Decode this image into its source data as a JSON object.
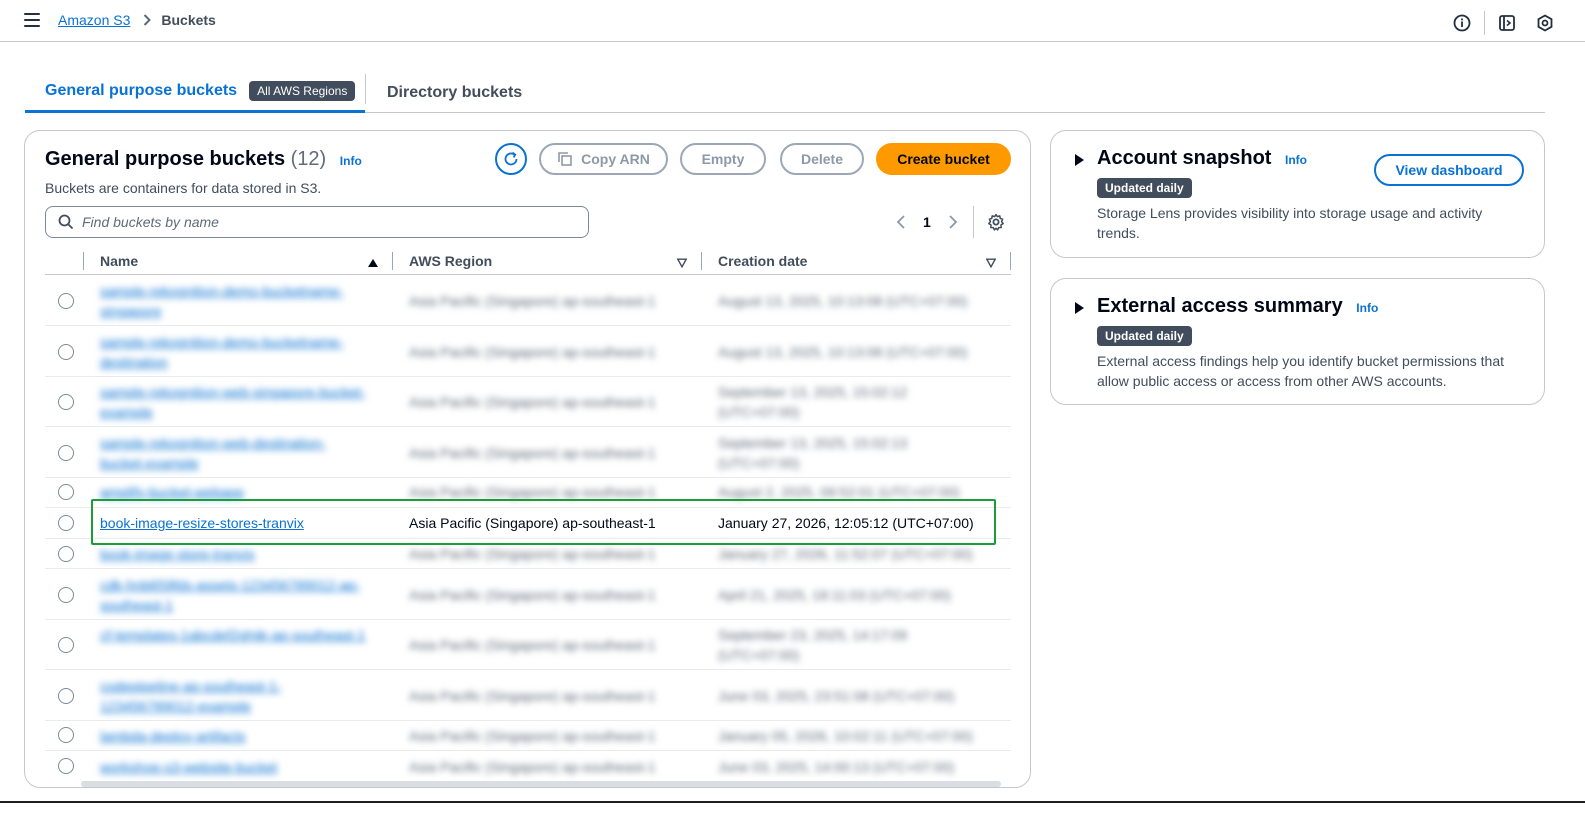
{
  "header": {
    "breadcrumb_root": "Amazon S3",
    "breadcrumb_current": "Buckets",
    "icons": [
      "menu-icon",
      "info-circle-icon",
      "side-panel-icon",
      "hexagon-settings-icon"
    ]
  },
  "tabs": {
    "general": "General purpose buckets",
    "general_badge": "All AWS Regions",
    "directory": "Directory buckets"
  },
  "buckets_panel": {
    "title": "General purpose buckets",
    "count": "(12)",
    "info": "Info",
    "description": "Buckets are containers for data stored in S3.",
    "buttons": {
      "copy_arn": "Copy ARN",
      "empty": "Empty",
      "delete": "Delete",
      "create": "Create bucket"
    },
    "search_placeholder": "Find buckets by name",
    "page_number": "1",
    "columns": {
      "name": "Name",
      "region": "AWS Region",
      "created": "Creation date"
    },
    "rows": [
      {
        "name": "sample-rekognition-demo-bucketname-singapore",
        "region": "Asia Pacific (Singapore) ap-southeast-1",
        "created": "August 13, 2025, 10:13:08 (UTC+07:00)"
      },
      {
        "name": "sample-rekognition-demo-bucketname-destination",
        "region": "Asia Pacific (Singapore) ap-southeast-1",
        "created": "August 13, 2025, 10:13:08 (UTC+07:00)"
      },
      {
        "name": "sample-rekognition-web-singapore-bucket-example",
        "region": "Asia Pacific (Singapore) ap-southeast-1",
        "created": "September 13, 2025, 15:02:12 (UTC+07:00)"
      },
      {
        "name": "sample-rekognition-web-destination-bucket-example",
        "region": "Asia Pacific (Singapore) ap-southeast-1",
        "created": "September 13, 2025, 15:02:13 (UTC+07:00)"
      },
      {
        "name": "amplify-bucket-webapp",
        "region": "Asia Pacific (Singapore) ap-southeast-1",
        "created": "August 2, 2025, 09:52:01 (UTC+07:00)"
      },
      {
        "name": "book-image-resize-stores-tranvix",
        "region": "Asia Pacific (Singapore) ap-southeast-1",
        "created": "January 27, 2026, 12:05:12 (UTC+07:00)"
      },
      {
        "name": "book-image-store-tranvix",
        "region": "Asia Pacific (Singapore) ap-southeast-1",
        "created": "January 27, 2026, 11:52:07 (UTC+07:00)"
      },
      {
        "name": "cdk-hnb659fds-assets-123456789012-ap-southeast-1",
        "region": "Asia Pacific (Singapore) ap-southeast-1",
        "created": "April 21, 2025, 18:11:03 (UTC+07:00)"
      },
      {
        "name": "cf-templates-1abcdef2ghijk-ap-southeast-1",
        "region": "Asia Pacific (Singapore) ap-southeast-1",
        "created": "September 23, 2025, 14:17:09 (UTC+07:00)"
      },
      {
        "name": "codepipeline-ap-southeast-1-123456789012-example",
        "region": "Asia Pacific (Singapore) ap-southeast-1",
        "created": "June 03, 2025, 23:51:08 (UTC+07:00)"
      },
      {
        "name": "lambda-deploy-artifacts",
        "region": "Asia Pacific (Singapore) ap-southeast-1",
        "created": "January 05, 2026, 10:02:11 (UTC+07:00)"
      },
      {
        "name": "workshop-s3-website-bucket",
        "region": "Asia Pacific (Singapore) ap-southeast-1",
        "created": "June 03, 2025, 14:00:13 (UTC+07:00)"
      }
    ]
  },
  "account_snapshot": {
    "title": "Account snapshot",
    "info": "Info",
    "badge": "Updated daily",
    "description": "Storage Lens provides visibility into storage usage and activity trends.",
    "button": "View dashboard"
  },
  "external_access": {
    "title": "External access summary",
    "info": "Info",
    "badge": "Updated daily",
    "description": "External access findings help you identify bucket permissions that allow public access or access from other AWS accounts."
  },
  "colors": {
    "accent": "#0972d3",
    "primary_button": "#ff9900",
    "highlight": "#1b9e3a"
  }
}
